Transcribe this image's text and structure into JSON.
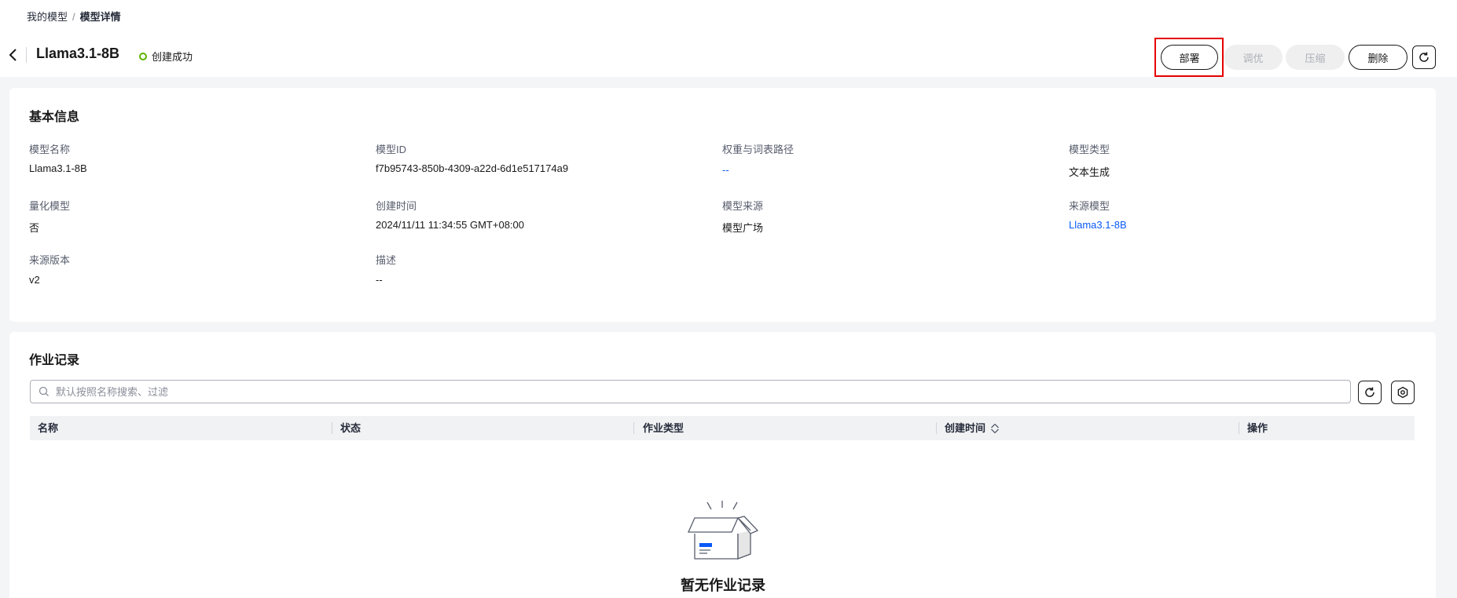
{
  "breadcrumb": {
    "root": "我的模型",
    "separator": "/",
    "current": "模型详情"
  },
  "header": {
    "title": "Llama3.1-8B",
    "status": "创建成功",
    "buttons": {
      "deploy": "部署",
      "tune": "调优",
      "compress": "压缩",
      "delete": "删除"
    }
  },
  "basic_info": {
    "title": "基本信息",
    "fields": [
      {
        "label": "模型名称",
        "value": "Llama3.1-8B"
      },
      {
        "label": "模型ID",
        "value": "f7b95743-850b-4309-a22d-6d1e517174a9"
      },
      {
        "label": "权重与词表路径",
        "value": "--"
      },
      {
        "label": "模型类型",
        "value": "文本生成"
      },
      {
        "label": "量化模型",
        "value": "否"
      },
      {
        "label": "创建时间",
        "value": "2024/11/11 11:34:55 GMT+08:00"
      },
      {
        "label": "模型来源",
        "value": "模型广场"
      },
      {
        "label": "来源模型",
        "value": "Llama3.1-8B"
      },
      {
        "label": "来源版本",
        "value": "v2"
      },
      {
        "label": "描述",
        "value": "--"
      }
    ]
  },
  "job_records": {
    "title": "作业记录",
    "search_placeholder": "默认按照名称搜索、过滤",
    "columns": [
      "名称",
      "状态",
      "作业类型",
      "创建时间",
      "操作"
    ],
    "empty_text": "暂无作业记录"
  },
  "colors": {
    "accent": "#0a59f7",
    "success": "#5cb300",
    "highlight": "#e60000"
  }
}
